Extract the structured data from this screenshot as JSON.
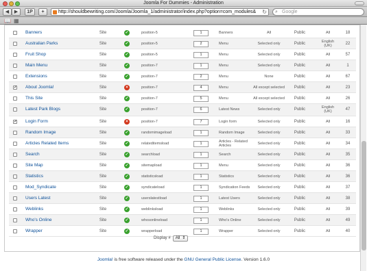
{
  "window": {
    "title": "Joomla For Dummies - Administration"
  },
  "toolbar": {
    "back_icon": "back-arrow-icon",
    "forward_icon": "forward-arrow-icon",
    "share_label": "1P",
    "add_label": "+",
    "url": "http://shouldbewriting.com/Joomla/Joomla_1/administrator/index.php?option=com_modules&",
    "search_placeholder": "Google"
  },
  "modules": [
    {
      "name": "Banners",
      "client": "Site",
      "enabled": true,
      "position": "position-5",
      "order": "1",
      "type": "Banners",
      "pages": "All",
      "access": "Public",
      "lang": "All",
      "id": "18",
      "checked": false
    },
    {
      "name": "Australian Parks",
      "client": "Site",
      "enabled": true,
      "position": "position-5",
      "order": "2",
      "type": "Menu",
      "pages": "Selected only",
      "access": "Public",
      "lang": "English (UK)",
      "id": "22",
      "checked": false
    },
    {
      "name": "Fruit Shop",
      "client": "Site",
      "enabled": true,
      "position": "position-5",
      "order": "1",
      "type": "Menu",
      "pages": "Selected only",
      "access": "Public",
      "lang": "All",
      "id": "57",
      "checked": false
    },
    {
      "name": "Main Menu",
      "client": "Site",
      "enabled": true,
      "position": "position-7",
      "order": "1",
      "type": "Menu",
      "pages": "Selected only",
      "access": "Public",
      "lang": "All",
      "id": "1",
      "checked": false
    },
    {
      "name": "Extensions",
      "client": "Site",
      "enabled": true,
      "position": "position-7",
      "order": "2",
      "type": "Menu",
      "pages": "None",
      "access": "Public",
      "lang": "All",
      "id": "67",
      "checked": false
    },
    {
      "name": "About Joomla!",
      "client": "Site",
      "enabled": false,
      "position": "position-7",
      "order": "4",
      "type": "Menu",
      "pages": "All except selected",
      "access": "Public",
      "lang": "All",
      "id": "23",
      "checked": true
    },
    {
      "name": "This Site",
      "client": "Site",
      "enabled": true,
      "position": "position-7",
      "order": "5",
      "type": "Menu",
      "pages": "All except selected",
      "access": "Public",
      "lang": "All",
      "id": "26",
      "checked": false
    },
    {
      "name": "Latest Park Blogs",
      "client": "Site",
      "enabled": true,
      "position": "position-7",
      "order": "6",
      "type": "Latest News",
      "pages": "Selected only",
      "access": "Public",
      "lang": "English (UK)",
      "id": "47",
      "checked": false
    },
    {
      "name": "Login Form",
      "client": "Site",
      "enabled": false,
      "position": "position-7",
      "order": "7",
      "type": "Login form",
      "pages": "Selected only",
      "access": "Public",
      "lang": "All",
      "id": "16",
      "checked": true
    },
    {
      "name": "Random Image",
      "client": "Site",
      "enabled": true,
      "position": "randomimageload",
      "order": "1",
      "type": "Random Image",
      "pages": "Selected only",
      "access": "Public",
      "lang": "All",
      "id": "33",
      "checked": false
    },
    {
      "name": "Articles Related Items",
      "client": "Site",
      "enabled": true,
      "position": "relateditemsload",
      "order": "1",
      "type": "Articles - Related Articles",
      "pages": "Selected only",
      "access": "Public",
      "lang": "All",
      "id": "34",
      "checked": false
    },
    {
      "name": "Search",
      "client": "Site",
      "enabled": true,
      "position": "searchload",
      "order": "1",
      "type": "Search",
      "pages": "Selected only",
      "access": "Public",
      "lang": "All",
      "id": "35",
      "checked": false
    },
    {
      "name": "Site Map",
      "client": "Site",
      "enabled": true,
      "position": "sitemapload",
      "order": "1",
      "type": "Menu",
      "pages": "Selected only",
      "access": "Public",
      "lang": "All",
      "id": "36",
      "checked": false
    },
    {
      "name": "Statistics",
      "client": "Site",
      "enabled": true,
      "position": "statisticsload",
      "order": "1",
      "type": "Statistics",
      "pages": "Selected only",
      "access": "Public",
      "lang": "All",
      "id": "36",
      "checked": false
    },
    {
      "name": "Mod_Syndicate",
      "client": "Site",
      "enabled": true,
      "position": "syndicateload",
      "order": "1",
      "type": "Syndication Feeds",
      "pages": "Selected only",
      "access": "Public",
      "lang": "All",
      "id": "37",
      "checked": false
    },
    {
      "name": "Users Latest",
      "client": "Site",
      "enabled": true,
      "position": "userslatestload",
      "order": "1",
      "type": "Latest Users",
      "pages": "Selected only",
      "access": "Public",
      "lang": "All",
      "id": "38",
      "checked": false
    },
    {
      "name": "Weblinks",
      "client": "Site",
      "enabled": true,
      "position": "weblinksload",
      "order": "1",
      "type": "Weblinks",
      "pages": "Selected only",
      "access": "Public",
      "lang": "All",
      "id": "39",
      "checked": false
    },
    {
      "name": "Who's Online",
      "client": "Site",
      "enabled": true,
      "position": "whosonlineload",
      "order": "1",
      "type": "Who's Online",
      "pages": "Selected only",
      "access": "Public",
      "lang": "All",
      "id": "49",
      "checked": false
    },
    {
      "name": "Wrapper",
      "client": "Site",
      "enabled": true,
      "position": "wrapperload",
      "order": "1",
      "type": "Wrapper",
      "pages": "Selected only",
      "access": "Public",
      "lang": "All",
      "id": "40",
      "checked": false
    }
  ],
  "pagination": {
    "display_label": "Display #",
    "display_value": "All"
  },
  "footer": {
    "joomla_link": "Joomla!",
    "text_mid": " is free software released under the ",
    "license_link": "GNU General Public License",
    "version": ".   Version 1.6.0"
  }
}
